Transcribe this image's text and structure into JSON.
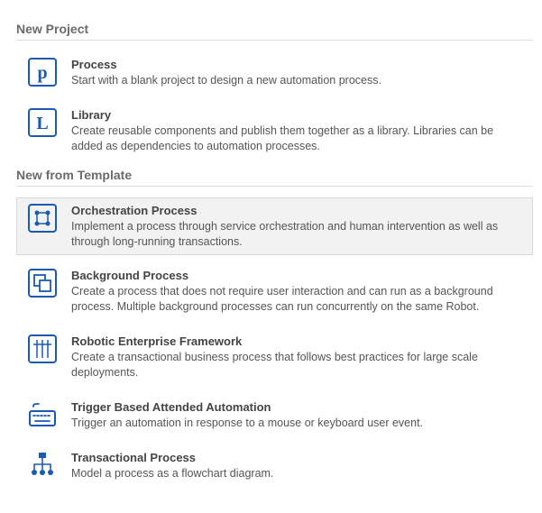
{
  "sections": {
    "new_project": {
      "header": "New Project",
      "items": {
        "process": {
          "title": "Process",
          "desc": "Start with a blank project to design a new automation process."
        },
        "library": {
          "title": "Library",
          "desc": "Create reusable components and publish them together as a library. Libraries can be added as dependencies to automation processes."
        }
      }
    },
    "new_from_template": {
      "header": "New from Template",
      "items": {
        "orchestration": {
          "title": "Orchestration Process",
          "desc": "Implement a process through service orchestration and human intervention as well as through long-running transactions."
        },
        "background": {
          "title": "Background Process",
          "desc": "Create a process that does not require user interaction and can run as a background process. Multiple background processes can run concurrently on the same Robot."
        },
        "ref": {
          "title": "Robotic Enterprise Framework",
          "desc": "Create a transactional business process that follows best practices for large scale deployments."
        },
        "trigger": {
          "title": "Trigger Based Attended Automation",
          "desc": "Trigger an automation in response to a mouse or keyboard user event."
        },
        "transactional": {
          "title": "Transactional Process",
          "desc": "Model a process as a flowchart diagram."
        }
      }
    }
  },
  "colors": {
    "icon_blue": "#1a5ab5"
  }
}
